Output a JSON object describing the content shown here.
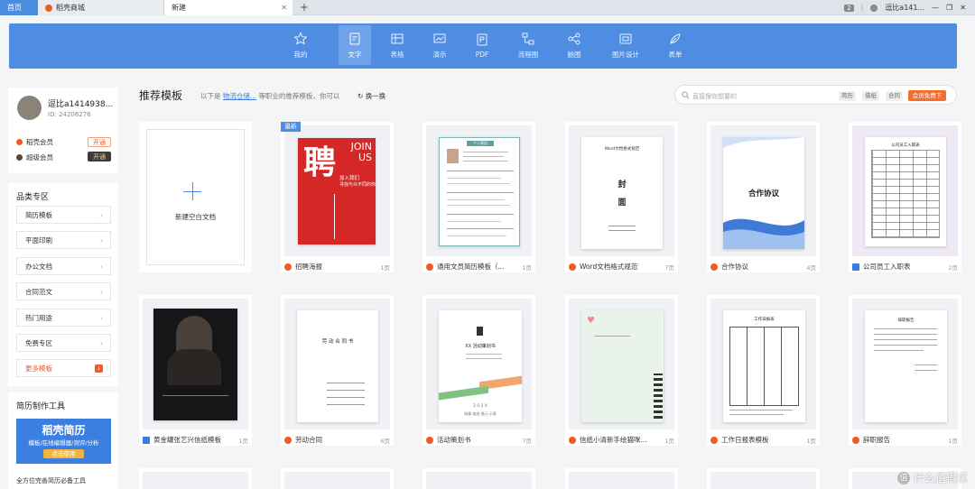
{
  "browser": {
    "tabs": [
      {
        "label": "首页"
      },
      {
        "label": "稻壳商城"
      },
      {
        "label": "新建"
      }
    ],
    "tab_count": "2",
    "user": "逗比a141..."
  },
  "toolbar": {
    "items": [
      {
        "label": "我的",
        "icon": "star-icon"
      },
      {
        "label": "文字",
        "icon": "document-icon"
      },
      {
        "label": "表格",
        "icon": "table-icon"
      },
      {
        "label": "演示",
        "icon": "presentation-icon"
      },
      {
        "label": "PDF",
        "icon": "pdf-icon"
      },
      {
        "label": "流程图",
        "icon": "flowchart-icon"
      },
      {
        "label": "脑图",
        "icon": "mindmap-icon"
      },
      {
        "label": "图片设计",
        "icon": "image-design-icon"
      },
      {
        "label": "表单",
        "icon": "form-icon"
      }
    ],
    "selected": "文字"
  },
  "profile": {
    "name": "逗比a1414938...",
    "id": "ID: 24206276",
    "rows": [
      {
        "label": "稻壳会员",
        "button": "开通",
        "dot": "#f05a28"
      },
      {
        "label": "超级会员",
        "button": "开通",
        "dot": "#5a4a2a"
      }
    ]
  },
  "category": {
    "title": "品类专区",
    "items": [
      "简历模板",
      "平面印刷",
      "办公文档",
      "合同范文",
      "热门用途",
      "免费专区"
    ],
    "more": "更多模板"
  },
  "resume_tools": {
    "title": "简历制作工具",
    "banner_title": "稻壳简历",
    "banner_sub": "模板/在线编辑器/测评/分析",
    "banner_btn": "点击使用",
    "footer": "全方位完善简历必备工具"
  },
  "main": {
    "heading": "推荐模板",
    "sub_prefix": "以下是",
    "sub_link": "物流仓储...",
    "sub_suffix": "等职业的推荐模板，你可以",
    "refresh": "换一换",
    "search_placeholder": "直接搜你想要的",
    "chips": [
      "简历",
      "借纸",
      "合同"
    ],
    "free_btn": "会员免费下"
  },
  "cards": [
    {
      "title": "新建空白文档",
      "pages": ""
    },
    {
      "title": "招聘海报",
      "pages": "1页",
      "tag": "最新",
      "poster_big": "聘",
      "poster_en": "JOIN US",
      "poster_l1": "加入我们",
      "poster_l2": "寻找与众不同的你"
    },
    {
      "title": "通用文员简历模板（...",
      "pages": "1页",
      "resume_head": "个人简历"
    },
    {
      "title": "Word文档格式规范",
      "pages": "7页",
      "doc_head": "Word文档格式规范",
      "cover1": "封",
      "cover2": "面"
    },
    {
      "title": "合作协议",
      "pages": "4页",
      "doc_head": "合作协议"
    },
    {
      "title": "公司员工入职表",
      "pages": "2页",
      "doc_head": "公司员工入职表"
    },
    {
      "title": "黄金罐张艺兴信纸模板",
      "pages": "1页"
    },
    {
      "title": "劳动合同",
      "pages": "6页",
      "doc_head": "劳 动 合 同 书"
    },
    {
      "title": "活动策划书",
      "pages": "7页",
      "doc_head": "XX 活动策划书",
      "doc_year": "2 0 2 X",
      "doc_foot": "城事 商成 借元 示意"
    },
    {
      "title": "信纸小清新手绘猫咪...",
      "pages": "1页"
    },
    {
      "title": "工作日报表模板",
      "pages": "1页",
      "doc_head": "工作日报表"
    },
    {
      "title": "辞职报告",
      "pages": "1页",
      "doc_head": "辞职报告"
    }
  ],
  "watermark": "什么值得买"
}
